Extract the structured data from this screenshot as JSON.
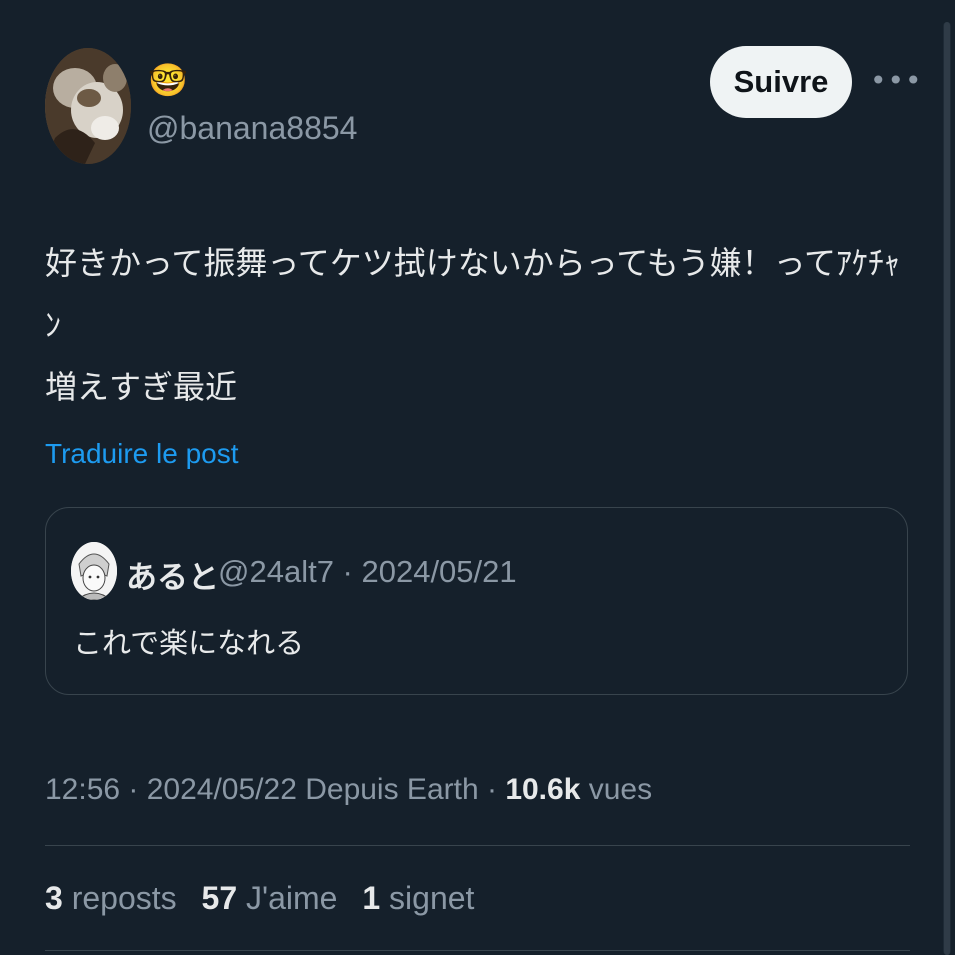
{
  "author": {
    "emoji": "🤓",
    "handle": "@banana8854"
  },
  "follow_button": "Suivre",
  "more_button": "•••",
  "post": {
    "lines": [
      "好きかって振舞ってケツ拭けないからってもう嫌！ってｱｹﾁｬﾝ",
      "増えすぎ最近"
    ]
  },
  "translate_link": "Traduire le post",
  "quoted_post": {
    "display_name": "あると",
    "meta": "@24alt7 · 2024/05/21",
    "text": "これで楽になれる"
  },
  "meta": {
    "time_date_source": "12:56 · 2024/05/22 Depuis Earth · ",
    "views_count": "10.6k",
    "views_label": " vues"
  },
  "stats": {
    "reposts_count": "3",
    "reposts_label": "reposts",
    "likes_count": "57",
    "likes_label": "J'aime",
    "bookmarks_count": "1",
    "bookmarks_label": "signet"
  }
}
